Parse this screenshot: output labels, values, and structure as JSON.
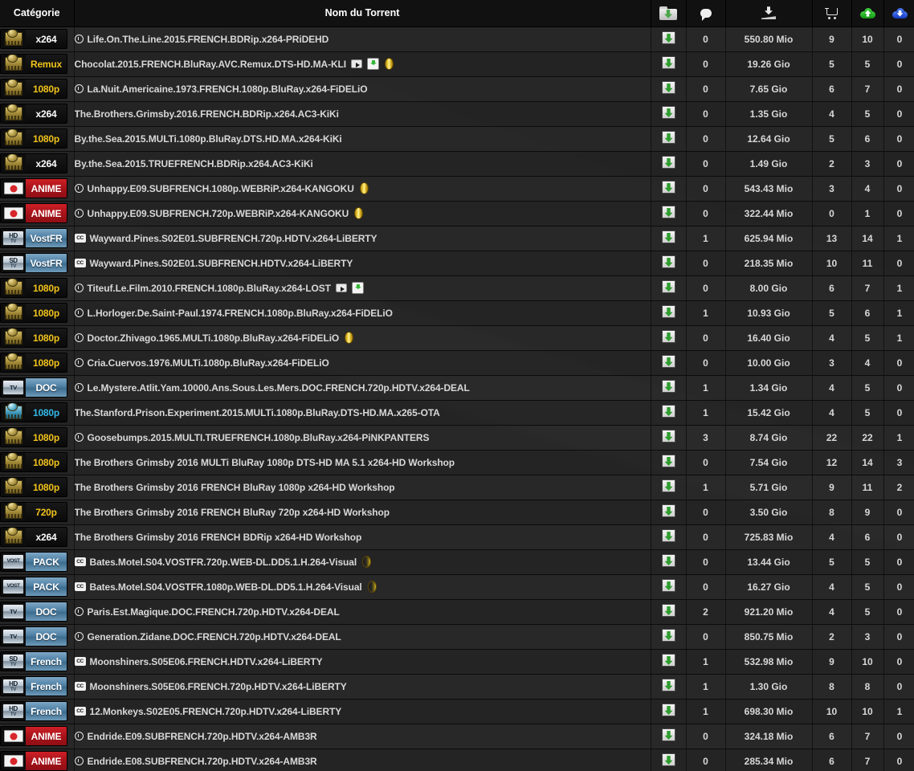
{
  "header": {
    "category_label": "Catégorie",
    "name_label": "Nom du Torrent",
    "icons": {
      "download": "folder-download-icon",
      "comments": "comment-bubble-icon",
      "size": "download-size-icon",
      "cart": "shopping-cart-icon",
      "seeders": "cloud-up-icon",
      "leechers": "cloud-down-icon",
      "favorite": "favorite-folder-icon"
    }
  },
  "colors": {
    "seed": "#26a326",
    "leech": "#2b5fd0",
    "gold": "#f0c21c",
    "cyan": "#33b7e8",
    "anime_red": "#cf2027",
    "tv_blue": "#4d7fa3",
    "row_bg": "#2c2c2c",
    "header_bg": "#111111"
  },
  "rows": [
    {
      "cat_icon": "film-reel-gold-icon",
      "cat_label": "x264",
      "cat_style": "lab-x264",
      "icon": "clock",
      "name": "Life.On.The.Line.2015.FRENCH.BDRip.x264-PRiDEHD",
      "extras": [],
      "comments": "0",
      "size": "550.80 Mio",
      "cart": "9",
      "seed": "10",
      "leech": "0"
    },
    {
      "cat_icon": "film-reel-gold-icon",
      "cat_label": "Remux",
      "cat_style": "lab-gold",
      "icon": "none",
      "name": "Chocolat.2015.FRENCH.BluRay.AVC.Remux.DTS-HD.MA-KLI",
      "extras": [
        "play",
        "greendl",
        "coin"
      ],
      "comments": "0",
      "size": "19.26 Gio",
      "cart": "5",
      "seed": "5",
      "leech": "0"
    },
    {
      "cat_icon": "film-reel-gold-icon",
      "cat_label": "1080p",
      "cat_style": "lab-gold",
      "icon": "clock",
      "name": "La.Nuit.Americaine.1973.FRENCH.1080p.BluRay.x264-FiDELiO",
      "extras": [],
      "comments": "0",
      "size": "7.65 Gio",
      "cart": "6",
      "seed": "7",
      "leech": "0"
    },
    {
      "cat_icon": "film-reel-gold-icon",
      "cat_label": "x264",
      "cat_style": "lab-x264",
      "icon": "none",
      "name": "The.Brothers.Grimsby.2016.FRENCH.BDRip.x264.AC3-KiKi",
      "extras": [],
      "comments": "0",
      "size": "1.35 Gio",
      "cart": "4",
      "seed": "5",
      "leech": "0"
    },
    {
      "cat_icon": "film-reel-gold-icon",
      "cat_label": "1080p",
      "cat_style": "lab-gold",
      "icon": "none",
      "name": "By.the.Sea.2015.MULTi.1080p.BluRay.DTS.HD.MA.x264-KiKi",
      "extras": [],
      "comments": "0",
      "size": "12.64 Gio",
      "cart": "5",
      "seed": "6",
      "leech": "0"
    },
    {
      "cat_icon": "film-reel-gold-icon",
      "cat_label": "x264",
      "cat_style": "lab-x264",
      "icon": "none",
      "name": "By.the.Sea.2015.TRUEFRENCH.BDRip.x264.AC3-KiKi",
      "extras": [],
      "comments": "0",
      "size": "1.49 Gio",
      "cart": "2",
      "seed": "3",
      "leech": "0"
    },
    {
      "cat_icon": "japan-flag-icon",
      "cat_label": "ANIME",
      "cat_style": "lab-anime",
      "icon": "clock",
      "name": "Unhappy.E09.SUBFRENCH.1080p.WEBRiP.x264-KANGOKU",
      "extras": [
        "coin"
      ],
      "comments": "0",
      "size": "543.43 Mio",
      "cart": "3",
      "seed": "4",
      "leech": "0"
    },
    {
      "cat_icon": "japan-flag-icon",
      "cat_label": "ANIME",
      "cat_style": "lab-anime",
      "icon": "clock",
      "name": "Unhappy.E09.SUBFRENCH.720p.WEBRiP.x264-KANGOKU",
      "extras": [
        "coin"
      ],
      "comments": "0",
      "size": "322.44 Mio",
      "cart": "0",
      "seed": "1",
      "leech": "0"
    },
    {
      "cat_icon": "hdtv-chip-icon",
      "cat_label": "VostFR",
      "cat_style": "lab-blue",
      "icon": "cc",
      "name": "Wayward.Pines.S02E01.SUBFRENCH.720p.HDTV.x264-LiBERTY",
      "extras": [],
      "comments": "1",
      "size": "625.94 Mio",
      "cart": "13",
      "seed": "14",
      "leech": "1"
    },
    {
      "cat_icon": "sdtv-chip-icon",
      "cat_label": "VostFR",
      "cat_style": "lab-blue",
      "icon": "cc",
      "name": "Wayward.Pines.S02E01.SUBFRENCH.HDTV.x264-LiBERTY",
      "extras": [],
      "comments": "0",
      "size": "218.35 Mio",
      "cart": "10",
      "seed": "11",
      "leech": "0"
    },
    {
      "cat_icon": "film-reel-gold-icon",
      "cat_label": "1080p",
      "cat_style": "lab-gold",
      "icon": "clock",
      "name": "Titeuf.Le.Film.2010.FRENCH.1080p.BluRay.x264-LOST",
      "extras": [
        "play",
        "greendl"
      ],
      "comments": "0",
      "size": "8.00 Gio",
      "cart": "6",
      "seed": "7",
      "leech": "1"
    },
    {
      "cat_icon": "film-reel-gold-icon",
      "cat_label": "1080p",
      "cat_style": "lab-gold",
      "icon": "clock",
      "name": "L.Horloger.De.Saint-Paul.1974.FRENCH.1080p.BluRay.x264-FiDELiO",
      "extras": [],
      "comments": "1",
      "size": "10.93 Gio",
      "cart": "5",
      "seed": "6",
      "leech": "1"
    },
    {
      "cat_icon": "film-reel-gold-icon",
      "cat_label": "1080p",
      "cat_style": "lab-gold",
      "icon": "clock",
      "name": "Doctor.Zhivago.1965.MULTi.1080p.BluRay.x264-FiDELiO",
      "extras": [
        "coin"
      ],
      "comments": "0",
      "size": "16.40 Gio",
      "cart": "4",
      "seed": "5",
      "leech": "1"
    },
    {
      "cat_icon": "film-reel-gold-icon",
      "cat_label": "1080p",
      "cat_style": "lab-gold",
      "icon": "clock",
      "name": "Cria.Cuervos.1976.MULTi.1080p.BluRay.x264-FiDELiO",
      "extras": [],
      "comments": "0",
      "size": "10.00 Gio",
      "cart": "3",
      "seed": "4",
      "leech": "0"
    },
    {
      "cat_icon": "tv-chip-icon",
      "cat_label": "DOC",
      "cat_style": "lab-blue",
      "icon": "clock",
      "name": "Le.Mystere.Atlit.Yam.10000.Ans.Sous.Les.Mers.DOC.FRENCH.720p.HDTV.x264-DEAL",
      "extras": [],
      "comments": "1",
      "size": "1.34 Gio",
      "cart": "4",
      "seed": "5",
      "leech": "0"
    },
    {
      "cat_icon": "film-reel-blue-icon",
      "cat_label": "1080p",
      "cat_style": "lab-cyan",
      "icon": "none",
      "name": "The.Stanford.Prison.Experiment.2015.MULTi.1080p.BluRay.DTS-HD.MA.x265-OTA",
      "extras": [],
      "comments": "1",
      "size": "15.42 Gio",
      "cart": "4",
      "seed": "5",
      "leech": "0"
    },
    {
      "cat_icon": "film-reel-gold-icon",
      "cat_label": "1080p",
      "cat_style": "lab-gold",
      "icon": "clock",
      "name": "Goosebumps.2015.MULTI.TRUEFRENCH.1080p.BluRay.x264-PiNKPANTERS",
      "extras": [],
      "comments": "3",
      "size": "8.74 Gio",
      "cart": "22",
      "seed": "22",
      "leech": "1"
    },
    {
      "cat_icon": "film-reel-gold-icon",
      "cat_label": "1080p",
      "cat_style": "lab-gold",
      "icon": "none",
      "name": "The Brothers Grimsby 2016 MULTi BluRay 1080p DTS-HD MA 5.1 x264-HD Workshop",
      "extras": [],
      "comments": "0",
      "size": "7.54 Gio",
      "cart": "12",
      "seed": "14",
      "leech": "3"
    },
    {
      "cat_icon": "film-reel-gold-icon",
      "cat_label": "1080p",
      "cat_style": "lab-gold",
      "icon": "none",
      "name": "The Brothers Grimsby 2016 FRENCH BluRay 1080p x264-HD Workshop",
      "extras": [],
      "comments": "1",
      "size": "5.71 Gio",
      "cart": "9",
      "seed": "11",
      "leech": "2"
    },
    {
      "cat_icon": "film-reel-gold-icon",
      "cat_label": "720p",
      "cat_style": "lab-gold",
      "icon": "none",
      "name": "The Brothers Grimsby 2016 FRENCH BluRay 720p x264-HD Workshop",
      "extras": [],
      "comments": "0",
      "size": "3.50 Gio",
      "cart": "8",
      "seed": "9",
      "leech": "0"
    },
    {
      "cat_icon": "film-reel-gold-icon",
      "cat_label": "x264",
      "cat_style": "lab-x264",
      "icon": "none",
      "name": "The Brothers Grimsby 2016 FRENCH BDRip x264-HD Workshop",
      "extras": [],
      "comments": "0",
      "size": "725.83 Mio",
      "cart": "4",
      "seed": "6",
      "leech": "0"
    },
    {
      "cat_icon": "vost-chip-icon",
      "cat_label": "PACK",
      "cat_style": "lab-blue",
      "icon": "cc",
      "name": "Bates.Motel.S04.VOSTFR.720p.WEB-DL.DD5.1.H.264-Visual",
      "extras": [
        "coindark"
      ],
      "comments": "0",
      "size": "13.44 Gio",
      "cart": "5",
      "seed": "5",
      "leech": "0"
    },
    {
      "cat_icon": "vost-chip-icon",
      "cat_label": "PACK",
      "cat_style": "lab-blue",
      "icon": "cc",
      "name": "Bates.Motel.S04.VOSTFR.1080p.WEB-DL.DD5.1.H.264-Visual",
      "extras": [
        "coindark"
      ],
      "comments": "0",
      "size": "16.27 Gio",
      "cart": "4",
      "seed": "5",
      "leech": "0"
    },
    {
      "cat_icon": "tv-chip-icon",
      "cat_label": "DOC",
      "cat_style": "lab-blue",
      "icon": "clock",
      "name": "Paris.Est.Magique.DOC.FRENCH.720p.HDTV.x264-DEAL",
      "extras": [],
      "comments": "2",
      "size": "921.20 Mio",
      "cart": "4",
      "seed": "5",
      "leech": "0"
    },
    {
      "cat_icon": "tv-chip-icon",
      "cat_label": "DOC",
      "cat_style": "lab-blue",
      "icon": "clock",
      "name": "Generation.Zidane.DOC.FRENCH.720p.HDTV.x264-DEAL",
      "extras": [],
      "comments": "0",
      "size": "850.75 Mio",
      "cart": "2",
      "seed": "3",
      "leech": "0"
    },
    {
      "cat_icon": "sdtv-chip-icon",
      "cat_label": "French",
      "cat_style": "lab-blue",
      "icon": "cc",
      "name": "Moonshiners.S05E06.FRENCH.HDTV.x264-LiBERTY",
      "extras": [],
      "comments": "1",
      "size": "532.98 Mio",
      "cart": "9",
      "seed": "10",
      "leech": "0"
    },
    {
      "cat_icon": "hdtv-chip-icon",
      "cat_label": "French",
      "cat_style": "lab-blue",
      "icon": "cc",
      "name": "Moonshiners.S05E06.FRENCH.720p.HDTV.x264-LiBERTY",
      "extras": [],
      "comments": "1",
      "size": "1.30 Gio",
      "cart": "8",
      "seed": "8",
      "leech": "0"
    },
    {
      "cat_icon": "hdtv-chip-icon",
      "cat_label": "French",
      "cat_style": "lab-blue",
      "icon": "cc",
      "name": "12.Monkeys.S02E05.FRENCH.720p.HDTV.x264-LiBERTY",
      "extras": [],
      "comments": "1",
      "size": "698.30 Mio",
      "cart": "10",
      "seed": "10",
      "leech": "1"
    },
    {
      "cat_icon": "japan-flag-icon",
      "cat_label": "ANIME",
      "cat_style": "lab-anime",
      "icon": "clock",
      "name": "Endride.E09.SUBFRENCH.720p.HDTV.x264-AMB3R",
      "extras": [],
      "comments": "0",
      "size": "324.18 Mio",
      "cart": "6",
      "seed": "7",
      "leech": "0"
    },
    {
      "cat_icon": "japan-flag-icon",
      "cat_label": "ANIME",
      "cat_style": "lab-anime",
      "icon": "clock",
      "name": "Endride.E08.SUBFRENCH.720p.HDTV.x264-AMB3R",
      "extras": [],
      "comments": "0",
      "size": "285.34 Mio",
      "cart": "6",
      "seed": "7",
      "leech": "0"
    }
  ]
}
